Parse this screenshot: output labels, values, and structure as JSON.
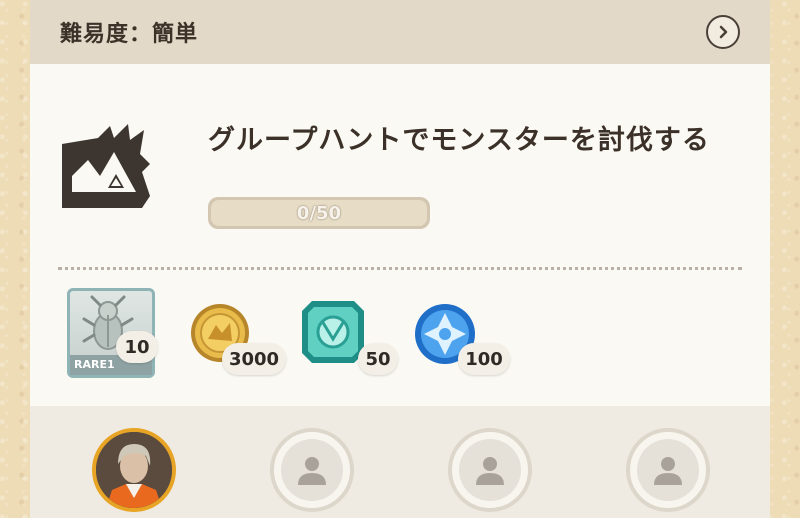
{
  "header": {
    "difficulty": "難易度：簡単"
  },
  "mission": {
    "title": "グループハントでモンスターを討伐する",
    "progress_text": "0/50",
    "progress_fraction": 0,
    "icon": "monster-jaw-icon"
  },
  "rewards": [
    {
      "name": "rare-material",
      "icon": "beetle-icon",
      "rarity": "RARE1",
      "count": "10"
    },
    {
      "name": "zenny-coin",
      "icon": "gold-coin-icon",
      "count": "3000"
    },
    {
      "name": "gem",
      "icon": "green-gem-icon",
      "count": "50"
    },
    {
      "name": "blue-orb",
      "icon": "blue-crystal-icon",
      "count": "100"
    }
  ],
  "slots": [
    {
      "type": "player"
    },
    {
      "type": "empty"
    },
    {
      "type": "empty"
    },
    {
      "type": "empty"
    }
  ],
  "colors": {
    "accent": "#e7a425",
    "header_bg": "#e2d9c8",
    "text": "#3b3129"
  }
}
